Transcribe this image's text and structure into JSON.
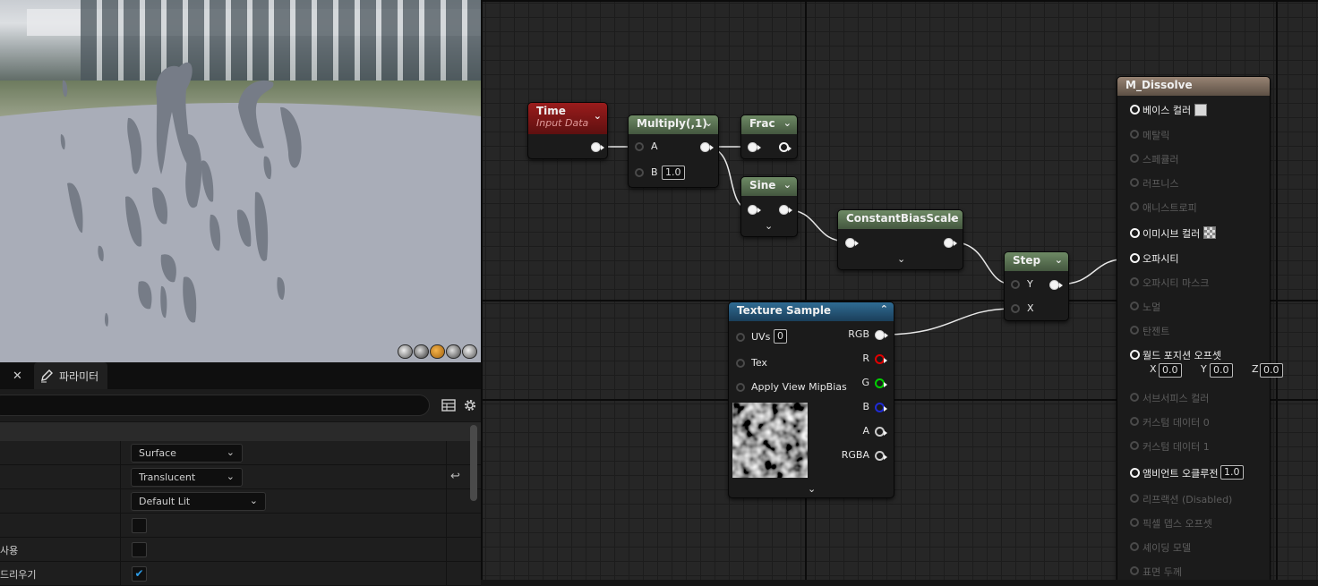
{
  "details": {
    "close_icon": "✕",
    "tab_label": "파라미터",
    "search_placeholder": "",
    "rows": [
      {
        "label": "",
        "value": "Surface"
      },
      {
        "label": "",
        "value": "Translucent"
      },
      {
        "label": "",
        "value": "Default Lit"
      },
      {
        "label": "",
        "checked": false
      },
      {
        "label": "사용",
        "checked": false
      },
      {
        "label": "드리우기",
        "checked": true
      }
    ],
    "reset_icon": "reset-arrow"
  },
  "nodes": {
    "time": {
      "title": "Time",
      "subtitle": "Input Data"
    },
    "multiply": {
      "title": "Multiply(,1)",
      "pin_a": "A",
      "pin_b": "B",
      "b_value": "1.0"
    },
    "frac": {
      "title": "Frac"
    },
    "sine": {
      "title": "Sine"
    },
    "cbs": {
      "title": "ConstantBiasScale"
    },
    "step": {
      "title": "Step",
      "pin_y": "Y",
      "pin_x": "X"
    },
    "texture": {
      "title": "Texture Sample",
      "uvs_label": "UVs",
      "uvs_value": "0",
      "tex_label": "Tex",
      "mip_label": "Apply View MipBias",
      "outputs": [
        "RGB",
        "R",
        "G",
        "B",
        "A",
        "RGBA"
      ]
    },
    "material": {
      "title": "M_Dissolve",
      "inputs": [
        {
          "label": "베이스 컬러",
          "active": true
        },
        {
          "label": "메탈릭",
          "active": false
        },
        {
          "label": "스페큘러",
          "active": false
        },
        {
          "label": "러프니스",
          "active": false
        },
        {
          "label": "애니스트로피",
          "active": false
        },
        {
          "label": "이미시브 컬러",
          "active": true
        },
        {
          "label": "오파시티",
          "active": true
        },
        {
          "label": "오파시티 마스크",
          "active": false
        },
        {
          "label": "노멀",
          "active": false
        },
        {
          "label": "탄젠트",
          "active": false
        },
        {
          "label": "월드 포지션 오프셋",
          "active": true
        },
        {
          "label": "서브서피스 컬러",
          "active": false
        },
        {
          "label": "커스텀 데이터 0",
          "active": false
        },
        {
          "label": "커스텀 데이터 1",
          "active": false
        },
        {
          "label": "앰비언트 오클루전",
          "active": true
        },
        {
          "label": "리프랙션 (Disabled)",
          "active": false
        },
        {
          "label": "픽셀 뎁스 오프셋",
          "active": false
        },
        {
          "label": "셰이딩 모델",
          "active": false
        },
        {
          "label": "표면 두께",
          "active": false
        }
      ],
      "wpo": {
        "x_label": "X",
        "x": "0.0",
        "y_label": "Y",
        "y": "0.0",
        "z_label": "Z",
        "z": "0.0"
      },
      "ao_value": "1.0"
    }
  },
  "colors": {
    "base_color_swatch": "#d8d8d8",
    "accent_check": "#2c9be6"
  }
}
